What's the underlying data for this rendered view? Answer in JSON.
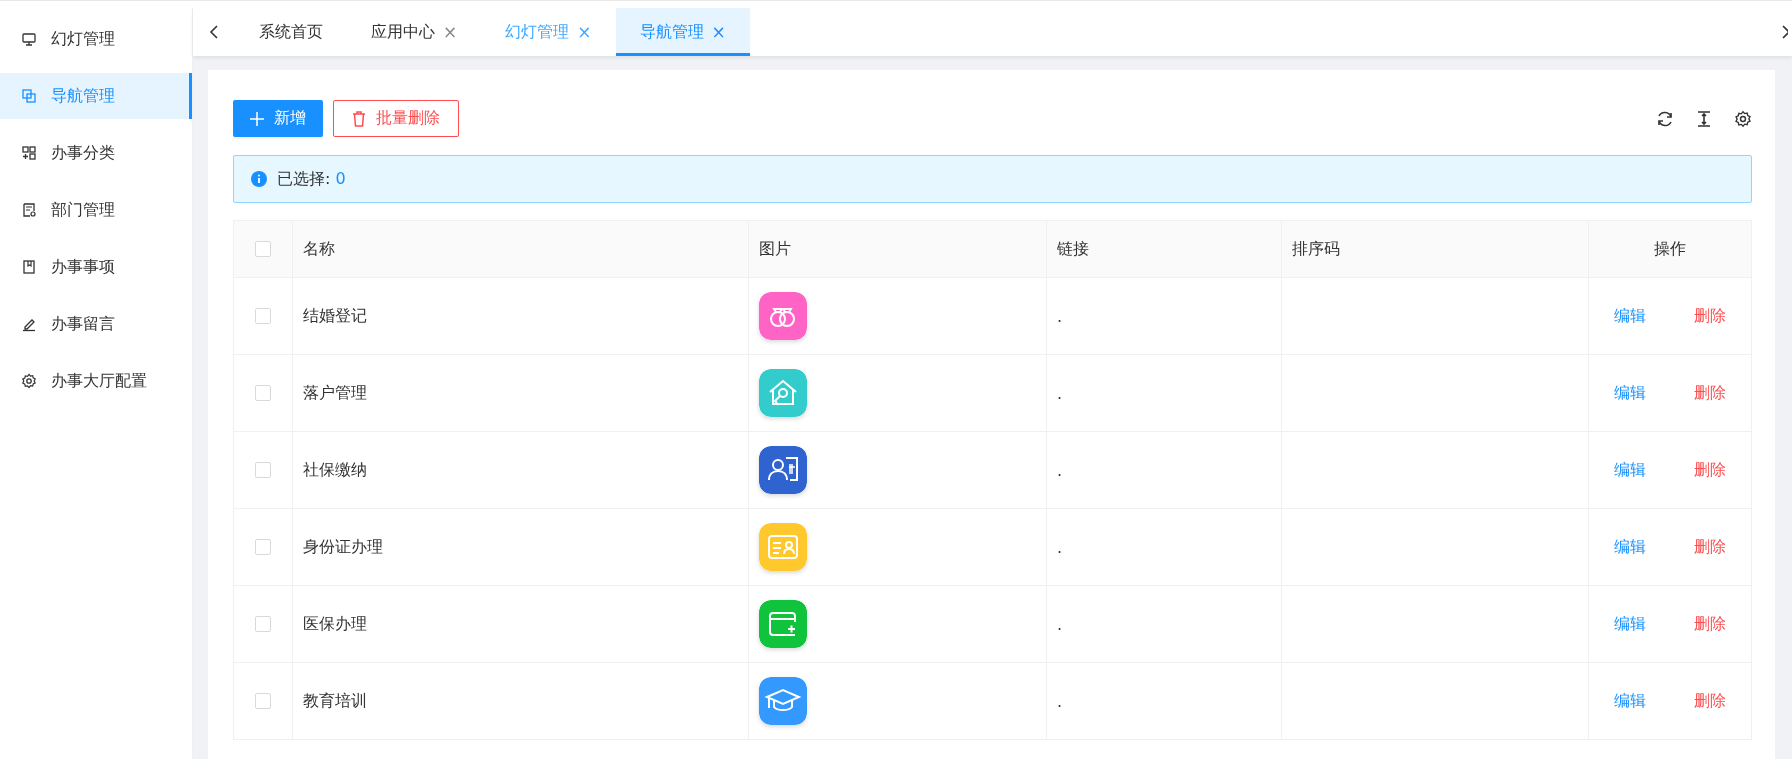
{
  "sidebar": {
    "items": [
      {
        "label": "幻灯管理",
        "kind": "monitor",
        "selected": false
      },
      {
        "label": "导航管理",
        "kind": "copy",
        "selected": true
      },
      {
        "label": "办事分类",
        "kind": "grid",
        "selected": false
      },
      {
        "label": "部门管理",
        "kind": "doc",
        "selected": false
      },
      {
        "label": "办事事项",
        "kind": "book",
        "selected": false
      },
      {
        "label": "办事留言",
        "kind": "pen",
        "selected": false
      },
      {
        "label": "办事大厅配置",
        "kind": "gear",
        "selected": false
      }
    ]
  },
  "tabs": [
    {
      "label": "系统首页",
      "closable": false,
      "hovered": false,
      "selected": false
    },
    {
      "label": "应用中心",
      "closable": true,
      "hovered": false,
      "selected": false
    },
    {
      "label": "幻灯管理",
      "closable": true,
      "hovered": true,
      "selected": false
    },
    {
      "label": "导航管理",
      "closable": true,
      "hovered": false,
      "selected": true
    }
  ],
  "tab_close": "×",
  "toolbar": {
    "add_button": "新增",
    "delete_button": "批量删除"
  },
  "alert": {
    "label": "已选择:",
    "count": "0"
  },
  "table": {
    "header_checked": false,
    "columns": [
      "名称",
      "图片",
      "链接",
      "排序码",
      "操作"
    ],
    "rows": [
      {
        "checked": false,
        "name": "结婚登记",
        "image": {
          "kind": "rings",
          "color": "#ff63c6"
        },
        "link": ".",
        "edit": "编辑",
        "delete": "删除"
      },
      {
        "checked": false,
        "name": "落户管理",
        "image": {
          "kind": "house",
          "color": "#33cccc"
        },
        "link": ".",
        "edit": "编辑",
        "delete": "删除"
      },
      {
        "checked": false,
        "name": "社保缴纳",
        "image": {
          "kind": "person-card",
          "color": "#2f63d0"
        },
        "link": ".",
        "edit": "编辑",
        "delete": "删除"
      },
      {
        "checked": false,
        "name": "身份证办理",
        "image": {
          "kind": "id-card",
          "color": "#ffc82c"
        },
        "link": ".",
        "edit": "编辑",
        "delete": "删除"
      },
      {
        "checked": false,
        "name": "医保办理",
        "image": {
          "kind": "wallet",
          "color": "#0fc33c"
        },
        "link": ".",
        "edit": "编辑",
        "delete": "删除"
      },
      {
        "checked": false,
        "name": "教育培训",
        "image": {
          "kind": "cap",
          "color": "#3399ff"
        },
        "link": ".",
        "edit": "编辑",
        "delete": "删除"
      }
    ]
  }
}
